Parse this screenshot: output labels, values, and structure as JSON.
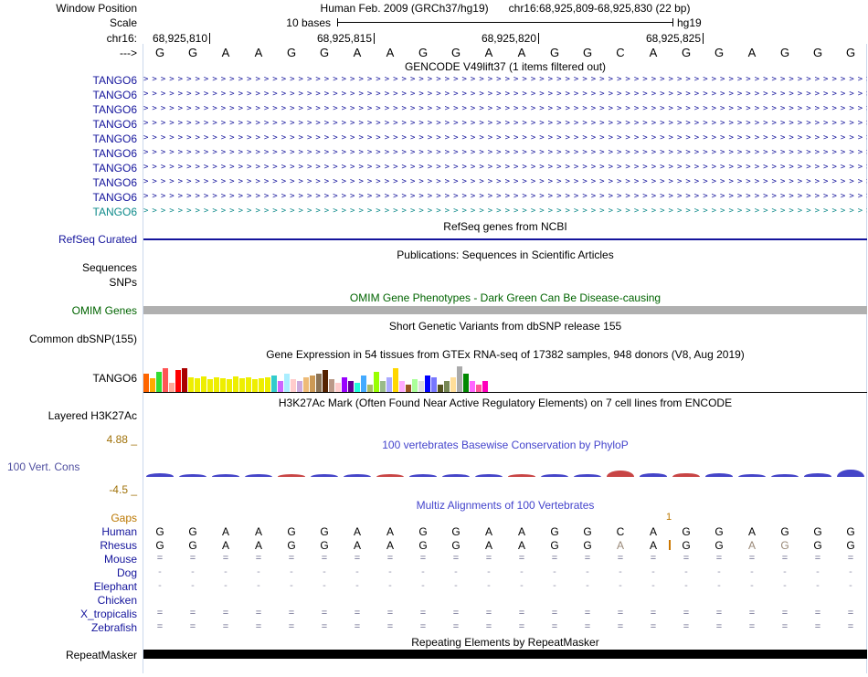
{
  "colors": {
    "track_blue": "#14149c",
    "teal": "#0d8a8a",
    "green": "#006400",
    "cons_blue": "#4444cc",
    "axis_brown": "#a0720a",
    "gaps_orange": "#bb7700",
    "insert_orange": "#cc7700",
    "light_letter": "#998877",
    "fill_eq": "#6b6b8d",
    "fill_dash": "#9a9ab0",
    "omim_bar": "#b0b0b0",
    "repeat_bar": "#000000",
    "guide": "#ccd9ec",
    "phylop_pos": "#4545c8",
    "phylop_neg": "#c84545"
  },
  "header": {
    "window_position_label": "Window Position",
    "assembly_title": "Human Feb. 2009 (GRCh37/hg19)",
    "position_title": "chr16:68,925,809-68,925,830 (22 bp)",
    "scale_label": "Scale",
    "scale_value": "10 bases",
    "assembly": "hg19",
    "chrom_label": "chr16:",
    "strand_label": "--->",
    "ruler_ticks": [
      {
        "label": "68,925,810",
        "boundary": 2
      },
      {
        "label": "68,925,815",
        "boundary": 7
      },
      {
        "label": "68,925,820",
        "boundary": 12
      },
      {
        "label": "68,925,825",
        "boundary": 17
      }
    ]
  },
  "sequence": [
    "G",
    "G",
    "A",
    "A",
    "G",
    "G",
    "A",
    "A",
    "G",
    "G",
    "A",
    "A",
    "G",
    "G",
    "C",
    "A",
    "G",
    "G",
    "A",
    "G",
    "G",
    "G"
  ],
  "gencode": {
    "title": "GENCODE V49lift37 (1 items filtered out)",
    "transcripts": [
      {
        "label": "TANGO6",
        "color": "#14149c"
      },
      {
        "label": "TANGO6",
        "color": "#14149c"
      },
      {
        "label": "TANGO6",
        "color": "#14149c"
      },
      {
        "label": "TANGO6",
        "color": "#14149c"
      },
      {
        "label": "TANGO6",
        "color": "#14149c"
      },
      {
        "label": "TANGO6",
        "color": "#14149c"
      },
      {
        "label": "TANGO6",
        "color": "#14149c"
      },
      {
        "label": "TANGO6",
        "color": "#14149c"
      },
      {
        "label": "TANGO6",
        "color": "#14149c"
      },
      {
        "label": "TANGO6",
        "color": "#0d8a8a"
      }
    ]
  },
  "refseq": {
    "title": "RefSeq genes from NCBI",
    "label": "RefSeq Curated"
  },
  "publications": {
    "title": "Publications: Sequences in Scientific Articles",
    "row1": "Sequences",
    "row2": "SNPs"
  },
  "omim": {
    "title": "OMIM Gene Phenotypes - Dark Green Can Be Disease-causing",
    "label": "OMIM Genes"
  },
  "dbsnp": {
    "title": "Short Genetic Variants from dbSNP release 155",
    "label": "Common dbSNP(155)"
  },
  "gtex": {
    "title": "Gene Expression in 54 tissues from GTEx RNA-seq of 17382 samples, 948 donors (V8, Aug 2019)",
    "label": "TANGO6"
  },
  "h3k27ac": {
    "title": "H3K27Ac Mark (Often Found Near Active Regulatory Elements) on 7 cell lines from ENCODE",
    "label": "Layered H3K27Ac"
  },
  "conservation": {
    "title": "100 vertebrates Basewise Conservation by PhyloP",
    "label": "100 Vert. Cons",
    "axis_max": "4.88 _",
    "axis_min": "-4.5 _"
  },
  "multiz": {
    "title": "Multiz Alignments of 100 Vertebrates",
    "gaps_label": "Gaps",
    "gap_count": "1",
    "insert_boundary": 16,
    "species": [
      {
        "name": "Human",
        "cells": "GGAAGGAAGGAAGGCAGGAGGG",
        "light": []
      },
      {
        "name": "Rhesus",
        "cells": "GGAAGGAAGGAAGGAAGGAGGG",
        "light": [
          14,
          18,
          19
        ]
      },
      {
        "name": "Mouse",
        "fill": "="
      },
      {
        "name": "Dog",
        "fill": "-"
      },
      {
        "name": "Elephant",
        "fill": "-"
      },
      {
        "name": "Chicken",
        "fill": ""
      },
      {
        "name": "X_tropicalis",
        "fill": "="
      },
      {
        "name": "Zebrafish",
        "fill": "="
      }
    ]
  },
  "repeat": {
    "title": "Repeating Elements by RepeatMasker",
    "label": "RepeatMasker"
  },
  "chart_data": [
    {
      "type": "bar",
      "title": "Gene Expression in 54 tissues from GTEx RNA-seq of 17382 samples, 948 donors (V8, Aug 2019)",
      "gene": "TANGO6",
      "note": "54 GTEx tissue expression bars; tissue names not shown in image; heights estimated in px (max ~28)",
      "values": [
        20,
        15,
        22,
        26,
        10,
        24,
        26,
        16,
        15,
        17,
        14,
        16,
        15,
        14,
        17,
        15,
        16,
        14,
        15,
        16,
        18,
        12,
        20,
        14,
        12,
        16,
        18,
        20,
        24,
        14,
        10,
        16,
        12,
        10,
        18,
        8,
        22,
        12,
        16,
        26,
        12,
        8,
        14,
        12,
        18,
        16,
        8,
        12,
        16,
        28,
        20,
        12,
        8,
        12
      ],
      "colors": [
        "#FF6600",
        "#FFAA00",
        "#33DD33",
        "#FF5555",
        "#FFAA99",
        "#FF0000",
        "#AA0000",
        "#EEEE00",
        "#EEEE00",
        "#EEEE00",
        "#EEEE00",
        "#EEEE00",
        "#EEEE00",
        "#EEEE00",
        "#EEEE00",
        "#EEEE00",
        "#EEEE00",
        "#EEEE00",
        "#EEEE00",
        "#EEEE00",
        "#33CCCC",
        "#CC66FF",
        "#AAEEFF",
        "#FFCCCC",
        "#CCAADD",
        "#EEBB77",
        "#CC9955",
        "#8B7355",
        "#552200",
        "#BB9988",
        "#FFCCCC",
        "#9900FF",
        "#660099",
        "#22FFDD",
        "#44AAFF",
        "#AABB66",
        "#99FF00",
        "#99BB88",
        "#AAAAFF",
        "#FFD700",
        "#FFAAFF",
        "#995522",
        "#AAFF99",
        "#DDDDDD",
        "#0000FF",
        "#7777FF",
        "#555522",
        "#778855",
        "#FFDD99",
        "#AAAAAA",
        "#008800",
        "#FF66FF",
        "#FF5599",
        "#FF00BB"
      ]
    },
    {
      "type": "area",
      "title": "100 vertebrates Basewise Conservation by PhyloP",
      "x_bases": 22,
      "ylim": [
        -4.5,
        4.88
      ],
      "values": [
        0.4,
        0.3,
        0.2,
        0.3,
        -0.2,
        0.3,
        0.3,
        -0.3,
        0.2,
        0.3,
        0.3,
        -0.2,
        0.3,
        0.3,
        -1.2,
        0.4,
        -0.6,
        0.4,
        0.3,
        0.3,
        0.4,
        1.6
      ]
    }
  ]
}
